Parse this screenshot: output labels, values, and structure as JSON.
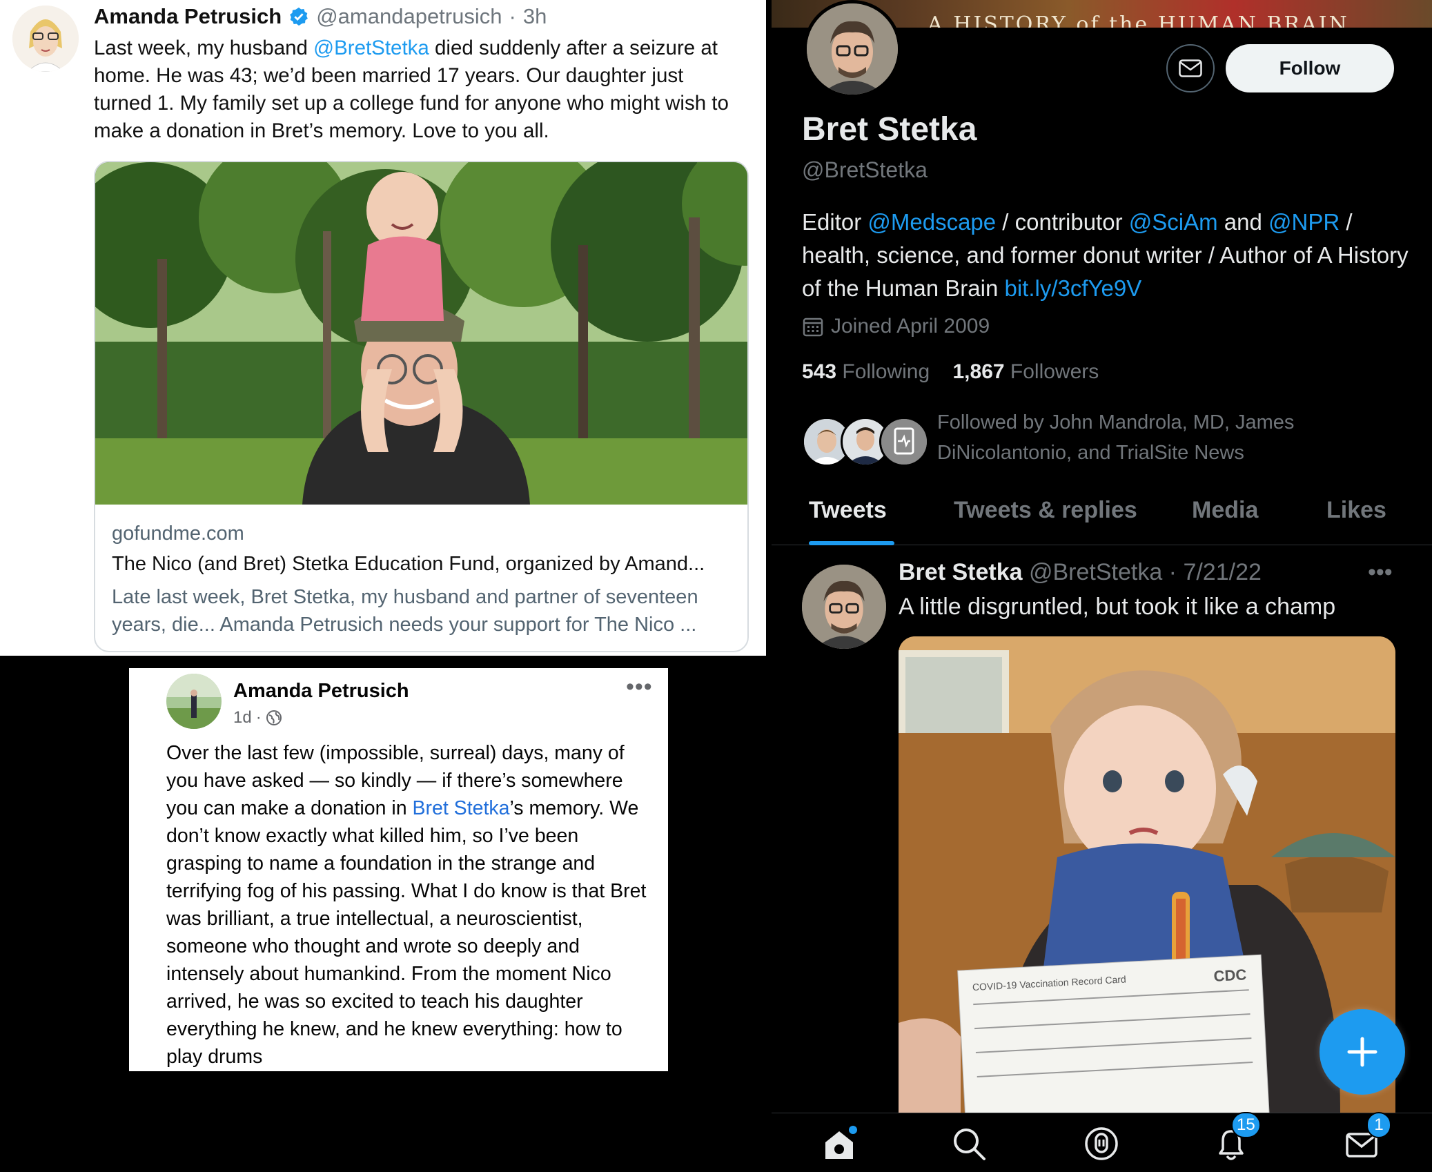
{
  "amanda_tweet": {
    "name": "Amanda Petrusich",
    "handle": "@amandapetrusich",
    "time": "3h",
    "text_1": "Last week, my husband ",
    "mention": "@BretStetka",
    "text_2": " died suddenly after a seizure at home. He was 43; we’d been married 17 years. Our daughter just turned 1. My family set up a college fund for anyone who might wish to make a donation in Bret’s memory. Love to you all.",
    "card": {
      "domain": "gofundme.com",
      "title": "The Nico (and Bret) Stetka Education Fund, organized by Amand...",
      "description": "Late last week, Bret Stetka, my husband and partner of seventeen years, die... Amanda Petrusich needs your support for The Nico ..."
    }
  },
  "facebook_post": {
    "name": "Amanda Petrusich",
    "time": "1d",
    "privacy_icon": "globe-icon",
    "text_1": "Over the last few (impossible, surreal) days, many of you have asked — so kindly — if there’s somewhere you can make a donation in ",
    "link": "Bret Stetka",
    "text_2": "’s memory. We don’t know exactly what killed him, so I’ve been grasping to name a foundation in the strange and terrifying fog of his passing. What I do know is that Bret was brilliant, a true intellectual, a neuroscientist, someone who thought and wrote so deeply and intensely about humankind. From the moment Nico arrived, he was so excited to teach his daughter everything he knew, and he knew everything: how to play drums"
  },
  "profile": {
    "banner_text": "A HISTORY of the HUMAN BRAIN",
    "follow_label": "Follow",
    "name": "Bret Stetka",
    "handle": "@BretStetka",
    "bio": {
      "p1": "Editor ",
      "m1": "@Medscape",
      "p2": " / contributor ",
      "m2": "@SciAm",
      "p3": " and ",
      "m3": "@NPR",
      "p4": " / health, science, and former donut writer / Author of A History of the Human Brain ",
      "url": "bit.ly/3cfYe9V"
    },
    "joined": "Joined April 2009",
    "following_count": "543",
    "following_label": "Following",
    "followers_count": "1,867",
    "followers_label": "Followers",
    "followed_by": "Followed by John Mandrola, MD, James DiNicolantonio, and TrialSite News",
    "tabs": [
      "Tweets",
      "Tweets & replies",
      "Media",
      "Likes"
    ],
    "active_tab": "Tweets",
    "tweet": {
      "name": "Bret Stetka",
      "handle": "@BretStetka",
      "date": "7/21/22",
      "text": "A little disgruntled, but took it like a champ",
      "card_title": "COVID-19 Vaccination Record Card",
      "card_logo": "CDC"
    },
    "nav": {
      "notifications_badge": "15",
      "messages_badge": "1"
    },
    "colors": {
      "accent": "#1d9bf0",
      "background": "#000000"
    }
  }
}
